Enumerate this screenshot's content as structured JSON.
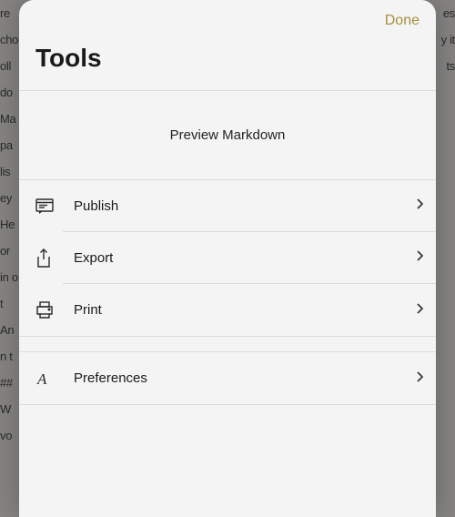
{
  "header": {
    "title": "Tools",
    "done": "Done"
  },
  "preview": {
    "label": "Preview Markdown"
  },
  "rows": {
    "publish": "Publish",
    "export": "Export",
    "print": "Print",
    "preferences": "Preferences"
  },
  "bg": {
    "left": "re\ncho\noll\ndo\nMa\npa\nlis\ney\nHe\nor\nin\no t\n\nAn\nn t\n\n##\n\nW\nvo",
    "right": "\n\n\n\nes\ny\n\n\n\nit\n\n\n\n\nts"
  }
}
